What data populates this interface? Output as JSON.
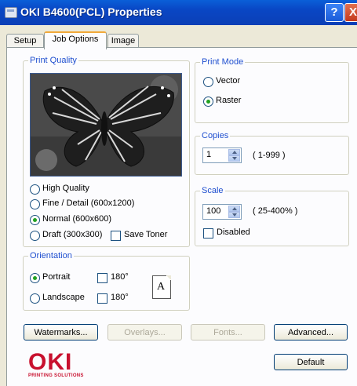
{
  "window": {
    "title": "OKI B4600(PCL) Properties",
    "help_label": "?",
    "close_label": "X"
  },
  "tabs": [
    {
      "label": "Setup",
      "active": false
    },
    {
      "label": "Job Options",
      "active": true
    },
    {
      "label": "Image",
      "active": false
    }
  ],
  "print_quality": {
    "group_label": "Print Quality",
    "options": [
      {
        "label": "High Quality",
        "selected": false
      },
      {
        "label": "Fine / Detail (600x1200)",
        "selected": false
      },
      {
        "label": "Normal (600x600)",
        "selected": true
      },
      {
        "label": "Draft (300x300)",
        "selected": false
      }
    ],
    "save_toner_label": "Save Toner",
    "save_toner_checked": false
  },
  "print_mode": {
    "group_label": "Print Mode",
    "options": [
      {
        "label": "Vector",
        "selected": false
      },
      {
        "label": "Raster",
        "selected": true
      }
    ]
  },
  "copies": {
    "group_label": "Copies",
    "value": "1",
    "range": "( 1-999 )"
  },
  "scale": {
    "group_label": "Scale",
    "value": "100",
    "range": "( 25-400% )",
    "disabled_label": "Disabled",
    "disabled_checked": false
  },
  "orientation": {
    "group_label": "Orientation",
    "portrait_label": "Portrait",
    "landscape_label": "Landscape",
    "portrait_selected": true,
    "rotate_label_1": "180°",
    "rotate_label_2": "180°",
    "page_letter": "A"
  },
  "buttons": {
    "watermarks": "Watermarks...",
    "overlays": "Overlays...",
    "fonts": "Fonts...",
    "advanced": "Advanced...",
    "default": "Default"
  },
  "logo": {
    "main": "OKI",
    "sub": "PRINTING SOLUTIONS"
  },
  "colors": {
    "title_bar": "#0946c4",
    "group_label": "#1f4fcf",
    "logo": "#c8102e"
  }
}
